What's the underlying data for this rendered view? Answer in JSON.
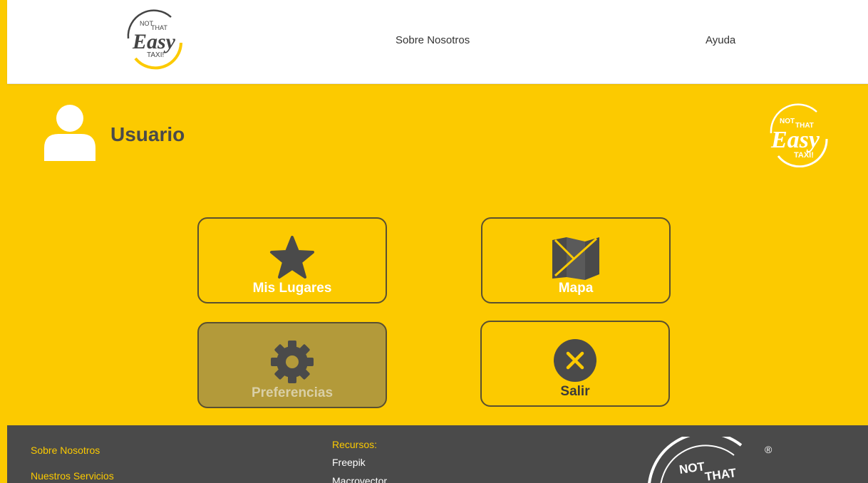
{
  "nav": {
    "logo": {
      "line1": "NOT",
      "line2": "THAT",
      "line3": "Easy",
      "line4": "TAXI!"
    },
    "links": [
      "Sobre Nosotros",
      "Ayuda"
    ]
  },
  "user": {
    "title": "Usuario",
    "icon": "user-icon"
  },
  "tiles": [
    {
      "label": "Mis Lugares",
      "icon": "star-icon"
    },
    {
      "label": "Mapa",
      "icon": "map-icon"
    },
    {
      "label": "Preferencias",
      "icon": "gear-icon"
    },
    {
      "label": "Salir",
      "icon": "close-icon"
    }
  ],
  "footer": {
    "links": [
      "Sobre Nosotros",
      "Nuestros Servicios"
    ],
    "resources_title": "Recursos:",
    "resources": [
      "Freepik",
      "Macrovector"
    ],
    "logo": {
      "line1": "NOT",
      "line2": "THAT"
    },
    "registered": "®"
  },
  "colors": {
    "brand_yellow": "#fcca00",
    "dark_gray": "#4a4a4a",
    "tile_border": "#5a5030",
    "tile_selected": "#b39a3a"
  }
}
